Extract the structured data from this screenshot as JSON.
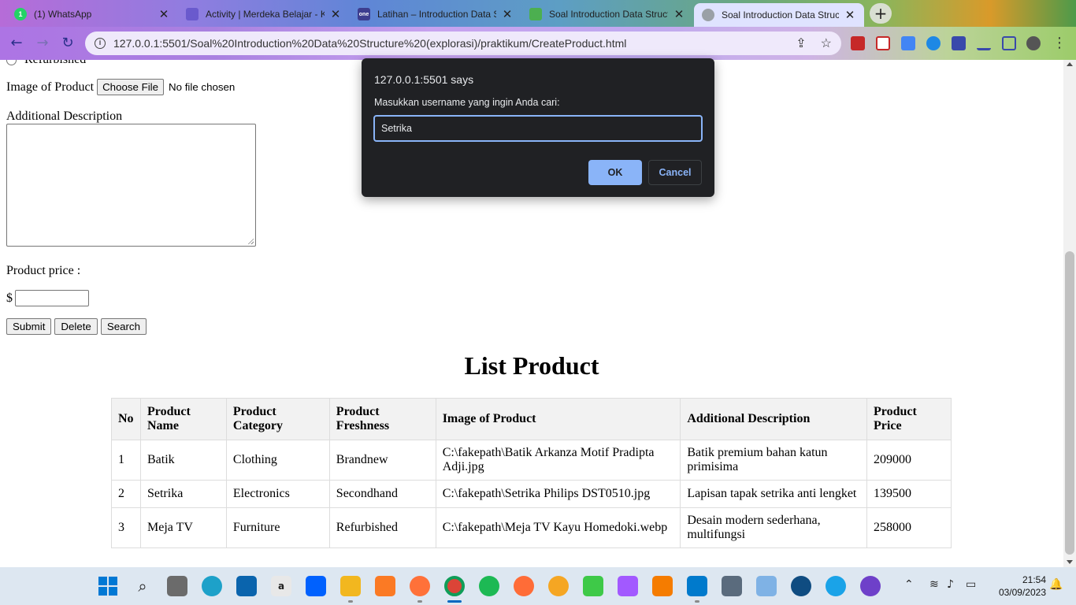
{
  "browser": {
    "tabs": [
      {
        "title": "(1) WhatsApp",
        "icon": "whatsapp-icon",
        "color": "#25d366"
      },
      {
        "title": "Activity | Merdeka Belajar - K",
        "icon": "merdeka-icon",
        "color": "#6a5acd"
      },
      {
        "title": "Latihan – Introduction Data S",
        "icon": "onenote-icon",
        "color": "#3d3d8f"
      },
      {
        "title": "Soal Introduction Data Struct",
        "icon": "book-icon",
        "color": "#4caf50"
      },
      {
        "title": "Soal Introduction Data Struct",
        "icon": "globe-icon",
        "color": "#9aa0a6"
      }
    ],
    "new_tab_symbol": "+",
    "url": "127.0.0.1:5501/Soal%20Introduction%20Data%20Structure%20(explorasi)/praktikum/CreateProduct.html"
  },
  "form": {
    "radio_label": "Refurbished",
    "image_label": "Image of Product",
    "choose_file_label": "Choose File",
    "no_file_text": "No file chosen",
    "description_label": "Additional Description",
    "price_label": "Product price :",
    "currency_symbol": "$",
    "buttons": {
      "submit": "Submit",
      "delete": "Delete",
      "search": "Search"
    }
  },
  "list": {
    "title": "List Product",
    "headers": [
      "No",
      "Product Name",
      "Product Category",
      "Product Freshness",
      "Image of Product",
      "Additional Description",
      "Product Price"
    ],
    "rows": [
      [
        "1",
        "Batik",
        "Clothing",
        "Brandnew",
        "C:\\fakepath\\Batik Arkanza Motif Pradipta Adji.jpg",
        "Batik premium bahan katun primisima",
        "209000"
      ],
      [
        "2",
        "Setrika",
        "Electronics",
        "Secondhand",
        "C:\\fakepath\\Setrika Philips DST0510.jpg",
        "Lapisan tapak setrika anti lengket",
        "139500"
      ],
      [
        "3",
        "Meja TV",
        "Furniture",
        "Refurbished",
        "C:\\fakepath\\Meja TV Kayu Homedoki.webp",
        "Desain modern sederhana, multifungsi",
        "258000"
      ]
    ]
  },
  "dialog": {
    "title": "127.0.0.1:5501 says",
    "message": "Masukkan username yang ingin Anda cari:",
    "input_value": "Setrika",
    "ok_label": "OK",
    "cancel_label": "Cancel"
  },
  "taskbar": {
    "time": "21:54",
    "date": "03/09/2023"
  },
  "colors": {
    "dialog_bg": "#202124",
    "dialog_accent": "#8ab4f8",
    "table_header_bg": "#f2f2f2"
  }
}
